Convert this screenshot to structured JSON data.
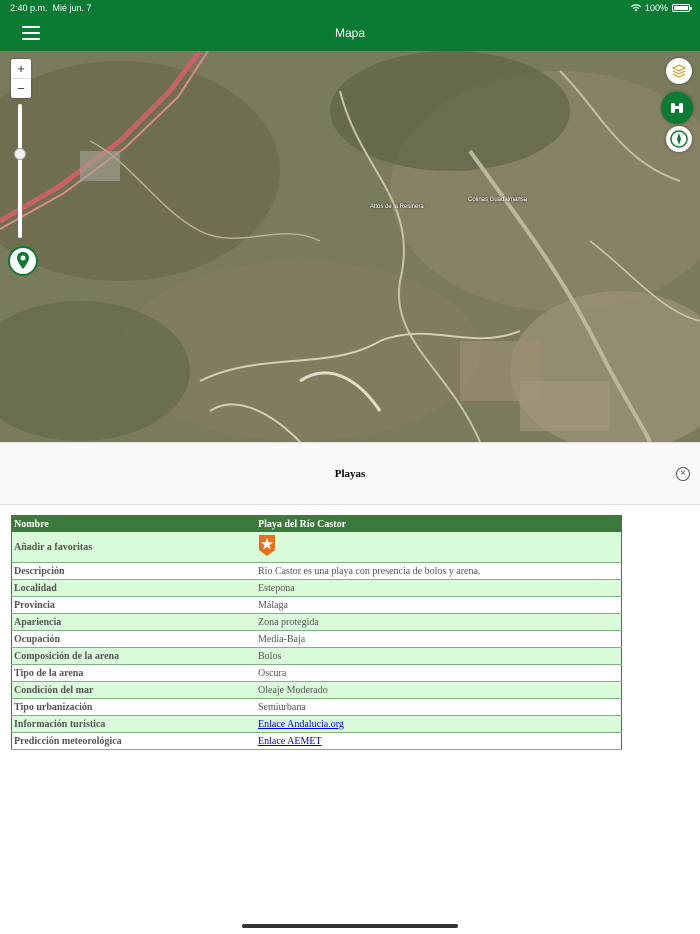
{
  "status": {
    "time": "2:40 p.m.",
    "date": "Mié jun. 7",
    "battery": "100%"
  },
  "nav": {
    "title": "Mapa"
  },
  "map": {
    "zoom_in": "+",
    "zoom_out": "−",
    "labels": [
      "Altos de la Resinera",
      "Colinas Guadalmansa"
    ]
  },
  "panel": {
    "title": "Playas",
    "close": "×"
  },
  "table": {
    "header": [
      "Nombre",
      "Playa del Río Castor"
    ],
    "favorites_label": "Añadir a favoritas",
    "rows": [
      [
        "Descripción",
        "Río Castor es una playa con presencia de bolos y arena."
      ],
      [
        "Localidad",
        "Estepona"
      ],
      [
        "Provincia",
        "Málaga"
      ],
      [
        "Apariencia",
        "Zona protegida"
      ],
      [
        "Ocupación",
        "Media-Baja"
      ],
      [
        "Composición de la arena",
        "Bolos"
      ],
      [
        "Tipo de la arena",
        "Oscura"
      ],
      [
        "Condición del mar",
        "Oleaje Moderado"
      ],
      [
        "Tipo urbanización",
        "Semiurbana"
      ]
    ],
    "links": [
      [
        "Información turística",
        "Enlace Andalucia.org"
      ],
      [
        "Predicción meteorológica",
        "Enlace AEMET"
      ]
    ]
  },
  "colors": {
    "brand": "#0b7a33",
    "table_header": "#3b7a3b",
    "row_alt": "#d9fbd9",
    "favorite": "#e8701a"
  }
}
